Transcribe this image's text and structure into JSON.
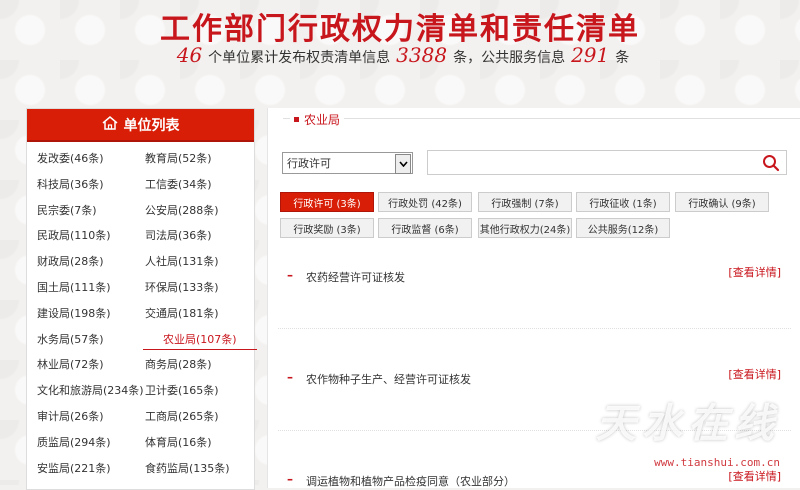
{
  "header": {
    "title": "工作部门行政权力清单和责任清单",
    "sub_units_count": "46",
    "sub_units_text": "个单位累计发布权责清单信息",
    "sub_info_count": "3388",
    "sub_info_text": "条，公共服务信息",
    "sub_service_count": "291",
    "sub_service_text": "条"
  },
  "sidebar": {
    "title": "单位列表",
    "units": [
      "发改委(46条)",
      "教育局(52条)",
      "科技局(36条)",
      "工信委(34条)",
      "民宗委(7条)",
      "公安局(288条)",
      "民政局(110条)",
      "司法局(36条)",
      "财政局(28条)",
      "人社局(131条)",
      "国土局(111条)",
      "环保局(133条)",
      "建设局(198条)",
      "交通局(181条)",
      "水务局(57条)",
      "农业局(107条)",
      "林业局(72条)",
      "商务局(28条)",
      "文化和旅游局(234条)",
      "卫计委(165条)",
      "审计局(26条)",
      "工商局(265条)",
      "质监局(294条)",
      "体育局(16条)",
      "安监局(221条)",
      "食药监局(135条)"
    ],
    "active": "农业局(107条)"
  },
  "main": {
    "dept": "农业局",
    "select_value": "行政许可",
    "filters": [
      "行政许可 (3条)",
      "行政处罚 (42条)",
      "行政强制 (7条)",
      "行政征收 (1条)",
      "行政确认 (9条)",
      "行政奖励 (3条)",
      "行政监督 (6条)",
      "其他行政权力(24条)",
      "公共服务(12条)"
    ],
    "active_filter": "行政许可 (3条)",
    "items": [
      {
        "name": "农药经营许可证核发",
        "detail": "[查看详情]"
      },
      {
        "name": "农作物种子生产、经营许可证核发",
        "detail": "[查看详情]"
      },
      {
        "name": "调运植物和植物产品检疫同意（农业部分）",
        "detail": "[查看详情]"
      }
    ]
  },
  "watermark": {
    "text": "天水在线",
    "url": "www.tianshui.com.cn"
  },
  "colors": {
    "accent": "#c8161d",
    "header_red": "#d81e06"
  }
}
